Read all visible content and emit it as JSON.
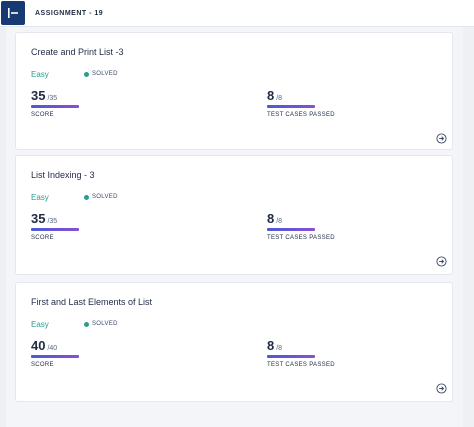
{
  "header": {
    "title": "ASSIGNMENT - 19",
    "menu_icon": "sidebar-toggle-icon"
  },
  "colors": {
    "brand": "#173a73",
    "easy": "#2a9d8f",
    "bar_start": "#4a5bd4",
    "bar_end": "#8a4fd2"
  },
  "problems": [
    {
      "title": "Create and Print List -3",
      "difficulty": "Easy",
      "status": "SOLVED",
      "score": "35",
      "score_total": "/35",
      "score_label": "SCORE",
      "tests": "8",
      "tests_total": "/8",
      "tests_label": "TEST CASES PASSED"
    },
    {
      "title": "List Indexing - 3",
      "difficulty": "Easy",
      "status": "SOLVED",
      "score": "35",
      "score_total": "/35",
      "score_label": "SCORE",
      "tests": "8",
      "tests_total": "/8",
      "tests_label": "TEST CASES PASSED"
    },
    {
      "title": "First and Last Elements of List",
      "difficulty": "Easy",
      "status": "SOLVED",
      "score": "40",
      "score_total": "/40",
      "score_label": "SCORE",
      "tests": "8",
      "tests_total": "/8",
      "tests_label": "TEST CASES PASSED"
    }
  ]
}
